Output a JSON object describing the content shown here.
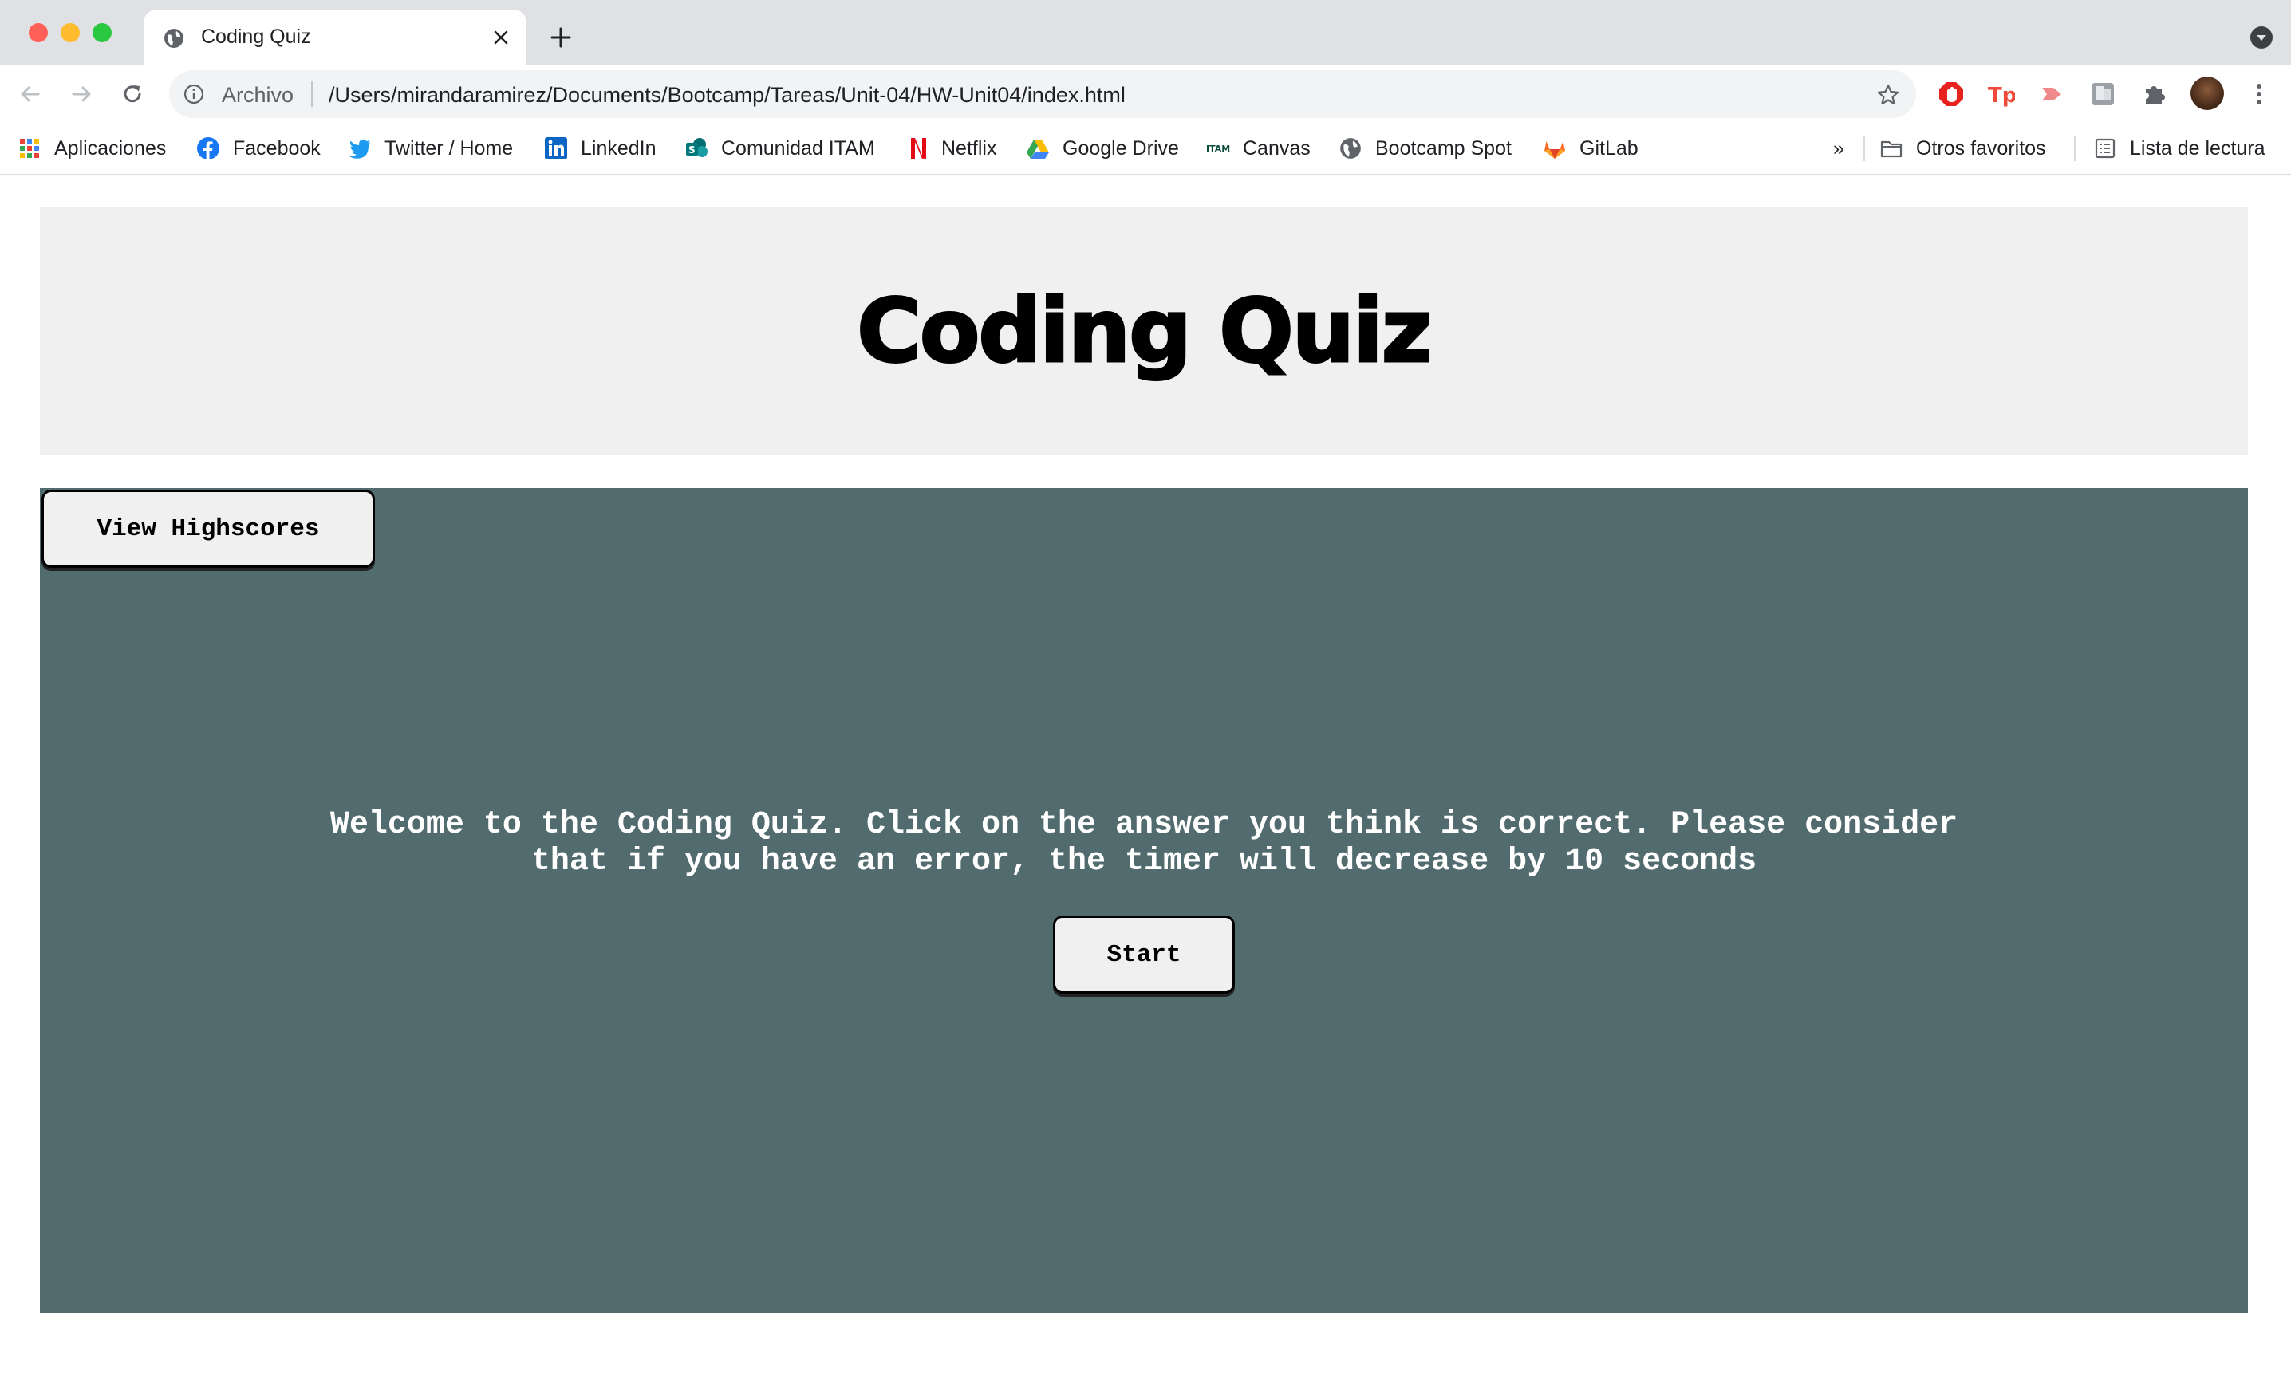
{
  "browser": {
    "tab": {
      "title": "Coding Quiz",
      "favicon": "globe-icon"
    },
    "omnibox": {
      "scheme_label": "Archivo",
      "url": "/Users/mirandaramirez/Documents/Bootcamp/Tareas/Unit-04/HW-Unit04/index.html"
    },
    "bookmarks": [
      {
        "label": "Aplicaciones",
        "icon": "apps-grid-icon"
      },
      {
        "label": "Facebook",
        "icon": "facebook-icon"
      },
      {
        "label": "Twitter / Home",
        "icon": "twitter-icon"
      },
      {
        "label": "LinkedIn",
        "icon": "linkedin-icon"
      },
      {
        "label": "Comunidad ITAM",
        "icon": "sharepoint-icon"
      },
      {
        "label": "Netflix",
        "icon": "netflix-icon"
      },
      {
        "label": "Google Drive",
        "icon": "google-drive-icon"
      },
      {
        "label": "Canvas",
        "icon": "itam-icon"
      },
      {
        "label": "Bootcamp Spot",
        "icon": "globe-icon"
      },
      {
        "label": "GitLab",
        "icon": "gitlab-icon"
      }
    ],
    "bookmarks_overflow": "»",
    "other_bookmarks": "Otros favoritos",
    "reading_list": "Lista de lectura",
    "colors": {
      "titlebar": "#dfe1e5",
      "omnibox": "#f1f3f4"
    }
  },
  "page": {
    "header_title": "Coding Quiz",
    "highscores_button": "View Highscores",
    "welcome_line_1": "Welcome to the Coding Quiz. Click on the answer you think is correct. Please consider",
    "welcome_line_2": "that if you have an error, the timer will decrease by 10 seconds",
    "start_button": "Start",
    "colors": {
      "header_bg": "#f0f0f0",
      "main_bg": "#516b6e",
      "button_bg": "#f0f0f0"
    }
  }
}
